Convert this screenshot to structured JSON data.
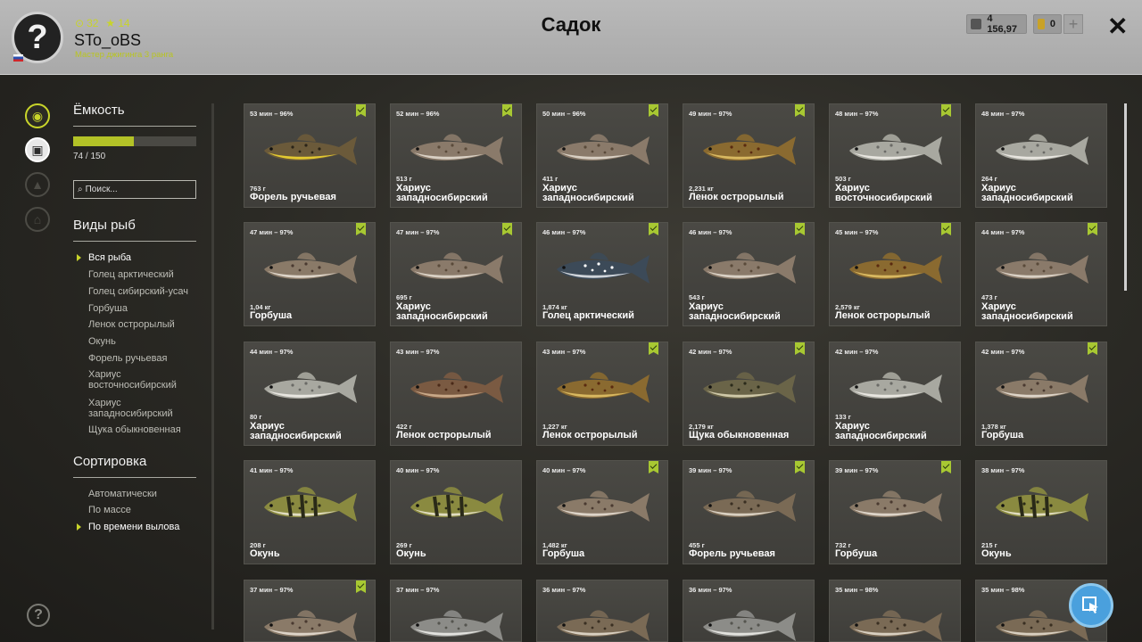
{
  "header": {
    "title": "Садок",
    "avatar_glyph": "?",
    "level": "32",
    "stars": "14",
    "nickname": "STo_oBS",
    "rank": "Мастер джигинга 3 ранга",
    "silver": "4 156,97",
    "gold": "0",
    "plus_label": "+",
    "close_label": "✕"
  },
  "left": {
    "capacity_title": "Ёмкость",
    "capacity_text": "74 / 150",
    "capacity_fraction": 0.493,
    "search_placeholder": "Поиск...",
    "species_title": "Виды рыб",
    "species": [
      "Вся рыба",
      "Голец арктический",
      "Голец сибирский-усач",
      "Горбуша",
      "Ленок острорылый",
      "Окунь",
      "Форель ручьевая",
      "Хариус\nвосточносибирский",
      "Хариус\nзападносибирский",
      "Щука обыкновенная"
    ],
    "sort_title": "Сортировка",
    "sort": [
      "Автоматически",
      "По массе",
      "По времени вылова"
    ]
  },
  "colors": {
    "accent": "#c8d42a",
    "fab": "#4aa0dd"
  },
  "cards": [
    {
      "time": "53 мин – 96%",
      "weight": "763 г",
      "name": "Форель ручьевая",
      "flag": true,
      "kind": "trout"
    },
    {
      "time": "52 мин – 96%",
      "weight": "513 г",
      "name": "Хариус\nзападносибирский",
      "flag": true,
      "kind": "grayling"
    },
    {
      "time": "50 мин – 96%",
      "weight": "411 г",
      "name": "Хариус\nзападносибирский",
      "flag": true,
      "kind": "grayling"
    },
    {
      "time": "49 мин – 97%",
      "weight": "2,231 кг",
      "name": "Ленок острорылый",
      "flag": true,
      "kind": "lenok"
    },
    {
      "time": "48 мин – 97%",
      "weight": "503 г",
      "name": "Хариус\nвосточносибирский",
      "flag": true,
      "kind": "grayling2"
    },
    {
      "time": "48 мин – 97%",
      "weight": "264 г",
      "name": "Хариус\nзападносибирский",
      "flag": false,
      "kind": "grayling2"
    },
    {
      "time": "47 мин – 97%",
      "weight": "1,04 кг",
      "name": "Горбуша",
      "flag": true,
      "kind": "pink"
    },
    {
      "time": "47 мин – 97%",
      "weight": "695 г",
      "name": "Хариус\nзападносибирский",
      "flag": true,
      "kind": "grayling"
    },
    {
      "time": "46 мин – 97%",
      "weight": "1,874 кг",
      "name": "Голец арктический",
      "flag": true,
      "kind": "char"
    },
    {
      "time": "46 мин – 97%",
      "weight": "543 г",
      "name": "Хариус\nзападносибирский",
      "flag": true,
      "kind": "grayling"
    },
    {
      "time": "45 мин – 97%",
      "weight": "2,579 кг",
      "name": "Ленок острорылый",
      "flag": true,
      "kind": "lenok"
    },
    {
      "time": "44 мин – 97%",
      "weight": "473 г",
      "name": "Хариус\nзападносибирский",
      "flag": true,
      "kind": "grayling"
    },
    {
      "time": "44 мин – 97%",
      "weight": "80 г",
      "name": "Хариус\nзападносибирский",
      "flag": false,
      "kind": "grayling2"
    },
    {
      "time": "43 мин – 97%",
      "weight": "422 г",
      "name": "Ленок острорылый",
      "flag": false,
      "kind": "lenok2"
    },
    {
      "time": "43 мин – 97%",
      "weight": "1,227 кг",
      "name": "Ленок острорылый",
      "flag": true,
      "kind": "lenok"
    },
    {
      "time": "42 мин – 97%",
      "weight": "2,179 кг",
      "name": "Щука обыкновенная",
      "flag": true,
      "kind": "pike"
    },
    {
      "time": "42 мин – 97%",
      "weight": "133 г",
      "name": "Хариус\nзападносибирский",
      "flag": false,
      "kind": "grayling2"
    },
    {
      "time": "42 мин – 97%",
      "weight": "1,378 кг",
      "name": "Горбуша",
      "flag": true,
      "kind": "pink"
    },
    {
      "time": "41 мин – 97%",
      "weight": "208 г",
      "name": "Окунь",
      "flag": false,
      "kind": "perch"
    },
    {
      "time": "40 мин – 97%",
      "weight": "269 г",
      "name": "Окунь",
      "flag": false,
      "kind": "perch"
    },
    {
      "time": "40 мин – 97%",
      "weight": "1,482 кг",
      "name": "Горбуша",
      "flag": true,
      "kind": "pink"
    },
    {
      "time": "39 мин – 97%",
      "weight": "455 г",
      "name": "Форель ручьевая",
      "flag": true,
      "kind": "trout2"
    },
    {
      "time": "39 мин – 97%",
      "weight": "732 г",
      "name": "Горбуша",
      "flag": true,
      "kind": "pink"
    },
    {
      "time": "38 мин – 97%",
      "weight": "215 г",
      "name": "Окунь",
      "flag": false,
      "kind": "perch"
    },
    {
      "time": "37 мин – 97%",
      "weight": "",
      "name": "",
      "flag": true,
      "kind": "pink"
    },
    {
      "time": "37 мин – 97%",
      "weight": "",
      "name": "",
      "flag": false,
      "kind": "pink2"
    },
    {
      "time": "36 мин – 97%",
      "weight": "",
      "name": "",
      "flag": false,
      "kind": "trout2"
    },
    {
      "time": "36 мин – 97%",
      "weight": "",
      "name": "",
      "flag": false,
      "kind": "pink2"
    },
    {
      "time": "35 мин – 98%",
      "weight": "",
      "name": "",
      "flag": false,
      "kind": "trout2"
    },
    {
      "time": "35 мин – 98%",
      "weight": "",
      "name": "",
      "flag": false,
      "kind": "trout2"
    }
  ]
}
